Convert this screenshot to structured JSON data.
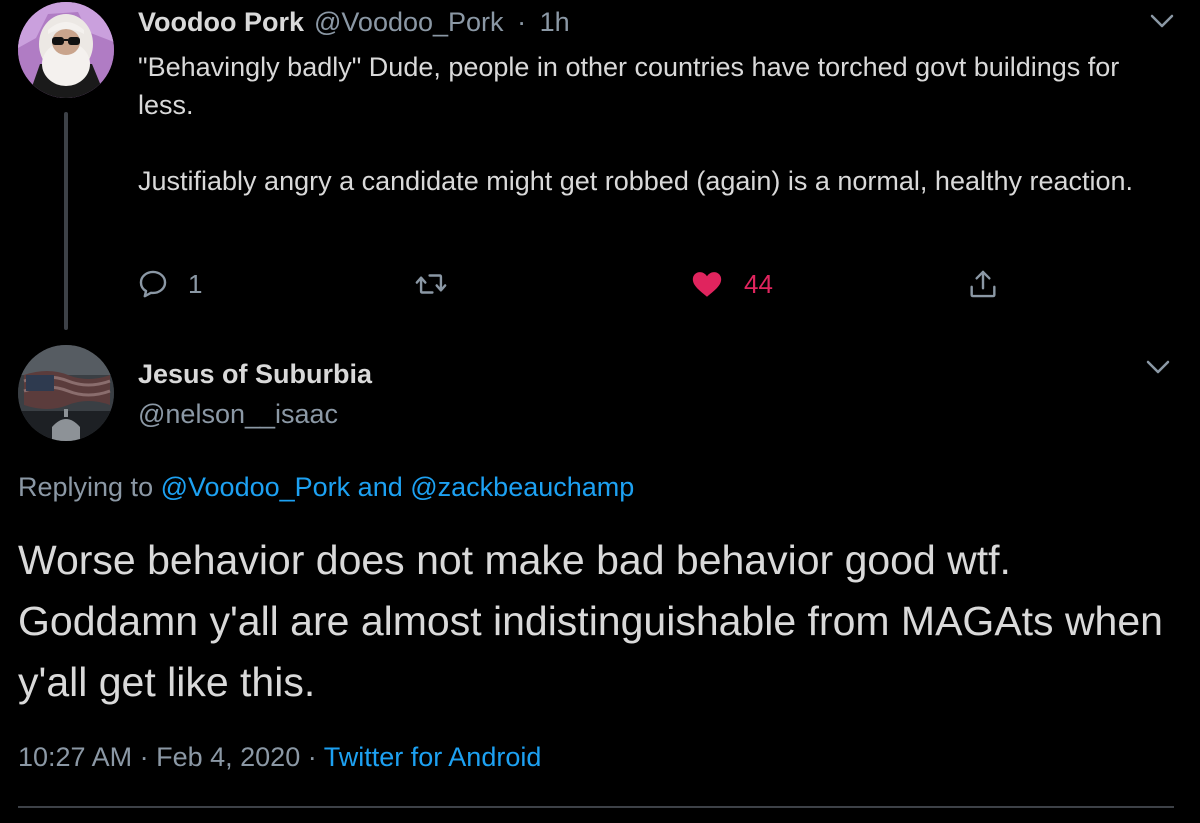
{
  "tweet1": {
    "display_name": "Voodoo Pork",
    "handle": "@Voodoo_Pork",
    "separator": "·",
    "time": "1h",
    "paragraphs": [
      "\"Behavingly badly\" Dude, people in other countries have torched govt buildings for less.",
      "Justifiably angry a candidate might get robbed (again) is a normal, healthy reaction."
    ],
    "actions": {
      "reply_count": "1",
      "like_count": "44"
    },
    "avatar_icon": "avatar-bearded-man-glasses"
  },
  "tweet2": {
    "display_name": "Jesus of Suburbia",
    "handle": "@nelson__isaac",
    "replying_prefix": "Replying to",
    "replying_to_1": "@Voodoo_Pork",
    "replying_and": "and",
    "replying_to_2": "@zackbeauchamp",
    "text": "Worse behavior does not make bad behavior good wtf. Goddamn y'all are almost indistinguishable from MAGAts when y'all get like this.",
    "time": "10:27 AM",
    "separator": "·",
    "date": "Feb 4, 2020",
    "source": "Twitter for Android",
    "avatar_icon": "avatar-flag-capitol"
  },
  "colors": {
    "background": "#000000",
    "text": "#d9d9d9",
    "secondary": "#8b98a5",
    "link": "#1da1f2",
    "like": "#e0245e",
    "divider": "#3d4147"
  }
}
